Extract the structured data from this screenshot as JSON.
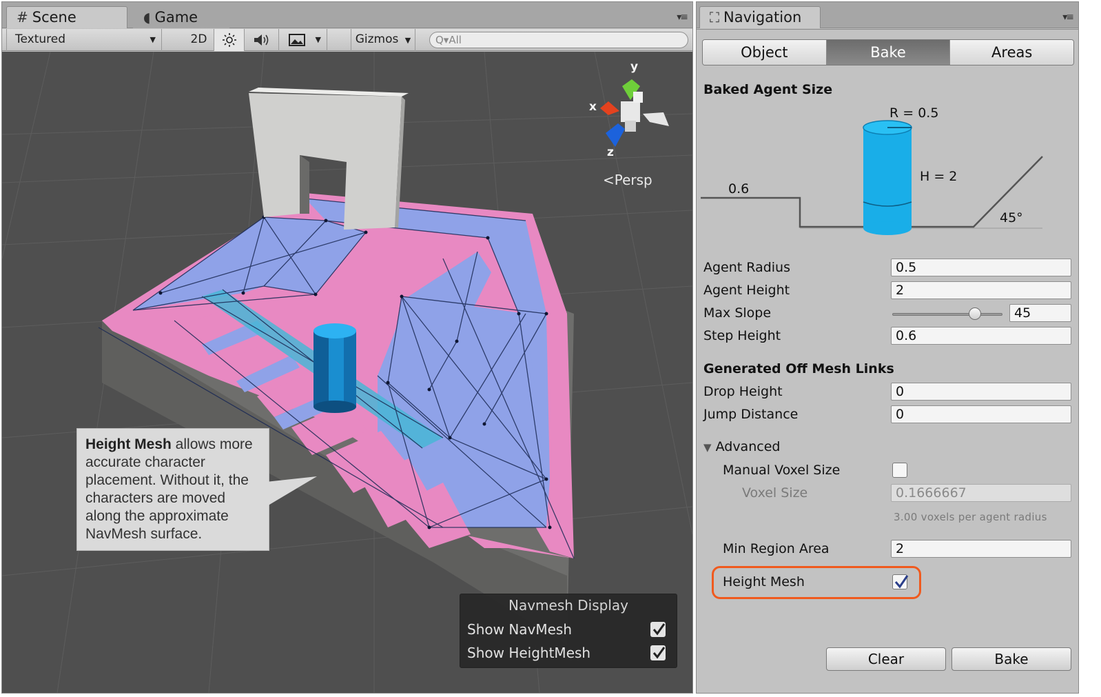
{
  "scene_window": {
    "tabs": [
      {
        "label": "Scene",
        "icon": "scene-hash-icon",
        "active": true
      },
      {
        "label": "Game",
        "icon": "game-pacman-icon",
        "active": false
      }
    ],
    "toolbar": {
      "draw_mode": "Textured",
      "mode_2d": "2D",
      "lighting_icon": "sun-icon",
      "audio_icon": "speaker-icon",
      "effects_icon": "image-icon",
      "gizmos": "Gizmos",
      "search_placeholder": "All"
    },
    "gizmo": {
      "x": "x",
      "y": "y",
      "z": "z",
      "projection": "Persp"
    },
    "callout": {
      "bold": "Height Mesh",
      "line1_rest": " allows more",
      "line2": "accurate character",
      "line3": "placement. Without it, the",
      "line4": "characters are moved",
      "line5": "along the approximate",
      "line6": "NavMesh surface."
    },
    "navmesh_display": {
      "title": "Navmesh Display",
      "show_navmesh": {
        "label": "Show NavMesh",
        "checked": true
      },
      "show_heightmesh": {
        "label": "Show HeightMesh",
        "checked": true
      }
    }
  },
  "navigation_window": {
    "tab_label": "Navigation",
    "tab_icon": "navigation-icon",
    "segments": [
      "Object",
      "Bake",
      "Areas"
    ],
    "selected_segment": "Bake",
    "baked_agent_size": {
      "header": "Baked Agent Size",
      "radius_label": "R = 0.5",
      "height_label": "H = 2",
      "step_label": "0.6",
      "slope_label": "45°"
    },
    "fields": {
      "agent_radius": {
        "label": "Agent Radius",
        "value": "0.5"
      },
      "agent_height": {
        "label": "Agent Height",
        "value": "2"
      },
      "max_slope": {
        "label": "Max Slope",
        "value": "45",
        "slider_fraction": 0.75
      },
      "step_height": {
        "label": "Step Height",
        "value": "0.6"
      }
    },
    "off_mesh_links": {
      "header": "Generated Off Mesh Links",
      "drop_height": {
        "label": "Drop Height",
        "value": "0"
      },
      "jump_distance": {
        "label": "Jump Distance",
        "value": "0"
      }
    },
    "advanced": {
      "header": "Advanced",
      "manual_voxel_size": {
        "label": "Manual Voxel Size",
        "checked": false
      },
      "voxel_size": {
        "label": "Voxel Size",
        "value": "0.1666667"
      },
      "voxel_note": "3.00 voxels per agent radius",
      "min_region_area": {
        "label": "Min Region Area",
        "value": "2"
      },
      "height_mesh": {
        "label": "Height Mesh",
        "checked": true
      }
    },
    "buttons": {
      "clear": "Clear",
      "bake": "Bake"
    },
    "colors": {
      "highlight": "#f05a1e",
      "agent_cylinder": "#19aee8",
      "navmesh_fill": "#8fa2e8",
      "navmesh_border": "#e889c2"
    }
  }
}
